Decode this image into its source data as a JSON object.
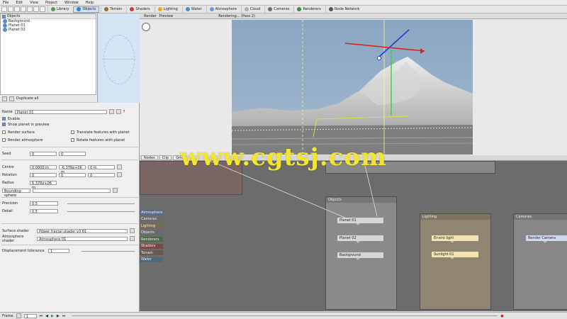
{
  "menu": [
    "File",
    "Edit",
    "View",
    "Project",
    "Window",
    "Help"
  ],
  "toolbar_tabs": [
    {
      "label": "Library",
      "color": "#4d9e4d"
    },
    {
      "label": "Objects",
      "color": "#3b7fd0",
      "active": true
    },
    {
      "label": "Terrain",
      "color": "#9b6a3a"
    },
    {
      "label": "Shaders",
      "color": "#c04040"
    },
    {
      "label": "Lighting",
      "color": "#e0b020"
    },
    {
      "label": "Water",
      "color": "#4090d0"
    },
    {
      "label": "Atmosphere",
      "color": "#6a9bd8"
    },
    {
      "label": "Cloud",
      "color": "#b0b0b0"
    },
    {
      "label": "Cameras",
      "color": "#707070"
    },
    {
      "label": "Renderers",
      "color": "#3a8a3a"
    },
    {
      "label": "Node Network",
      "color": "#555"
    }
  ],
  "tree": {
    "header": "Objects",
    "items": [
      "Background",
      "Planet 01",
      "Planet 02"
    ]
  },
  "duplicate_label": "Duplicate all",
  "props": {
    "name_label": "Name",
    "name_value": "Planet 01",
    "enable_label": "Enable",
    "show_preview_label": "Show planet in preview",
    "render_surface_label": "Render surface",
    "translate_label": "Translate features with planet",
    "render_atmos_label": "Render atmosphere",
    "rotate_label": "Rotate features with planet",
    "seed_label": "Seed",
    "seed_value": "0",
    "seed_value2": "0",
    "centre_label": "Centre",
    "centre_x": "0.0000 m",
    "centre_y": "-6.378e+06 m",
    "centre_z": "0 m",
    "rotation_label": "Rotation",
    "rotation_x": "0",
    "rotation_y": "0",
    "rotation_z": "0",
    "radius_label": "Radius",
    "radius_value": "6.378e+06 m",
    "bounding_label": "Bounding sphere",
    "precision_label": "Precision",
    "precision_value": "0.5",
    "detail_label": "Detail",
    "detail_value": "0.5",
    "surface_shader_label": "Surface shader",
    "surface_shader_value": "Power fractal shader v3 01",
    "atmos_shader_label": "Atmosphere shader",
    "atmos_shader_value": "Atmosphere 01",
    "displacement_label": "Displacement tolerance",
    "displacement_value": "1"
  },
  "viewport": {
    "tabs": [
      "Render",
      "Preview"
    ],
    "status": "Rendering... (Pass 2)"
  },
  "node_tabs": [
    "Nodes",
    "Clip",
    "Grid"
  ],
  "categories": [
    {
      "label": "Atmosphere",
      "color": "#5a6a8a"
    },
    {
      "label": "Cameras",
      "color": "#6a6a6a"
    },
    {
      "label": "Lighting",
      "color": "#7a6a50"
    },
    {
      "label": "Objects",
      "color": "#6a6a70"
    },
    {
      "label": "Renderers",
      "color": "#4a6a4a"
    },
    {
      "label": "Shaders",
      "color": "#7a4a4a"
    },
    {
      "label": "Terrain",
      "color": "#6a5a4a"
    },
    {
      "label": "Water",
      "color": "#4a6a7a"
    }
  ],
  "groups": {
    "objects": "Objects",
    "lighting": "Lighting",
    "cameras": "Cameras"
  },
  "nodes": {
    "planet1": "Planet 01",
    "planet2": "Planet 02",
    "background": "Background",
    "enviro": "Enviro light",
    "sunlight": "Sunlight 01",
    "camera": "Render Camera"
  },
  "status": {
    "frame_label": "Frame",
    "frame_value": "1"
  },
  "watermark": "www.cgtsj.com"
}
